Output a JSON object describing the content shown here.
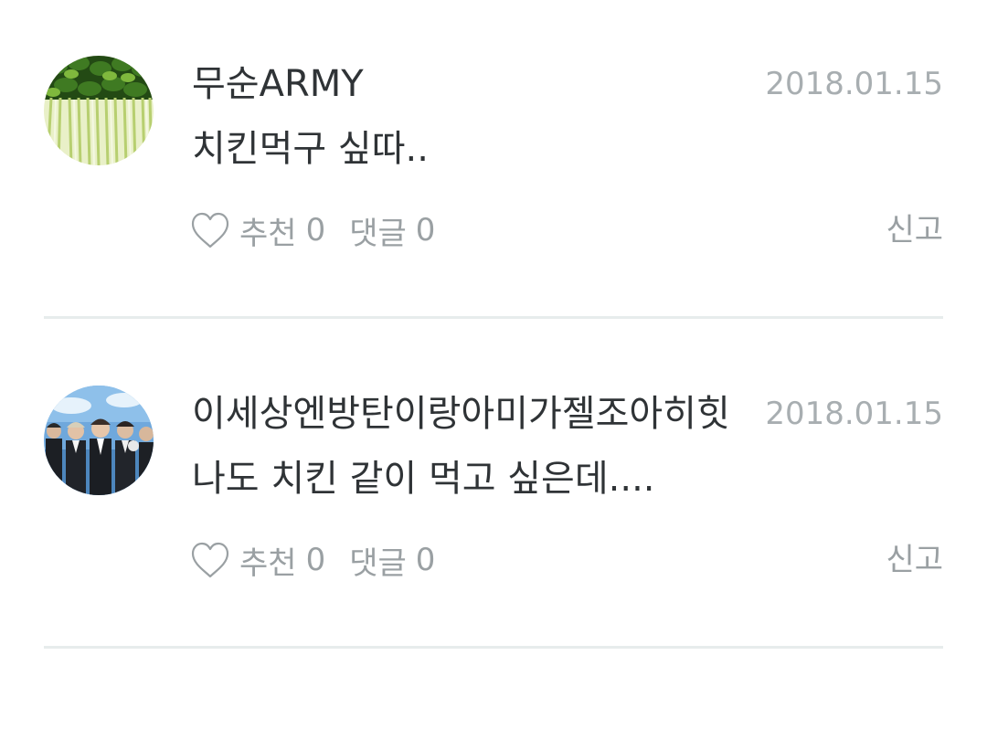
{
  "comments": [
    {
      "username": "무순ARMY",
      "date": "2018.01.15",
      "text": "치킨먹구 싶따..",
      "like_label": "추천",
      "like_count": "0",
      "reply_label": "댓글",
      "reply_count": "0",
      "report_label": "신고",
      "avatar_icon": "sprouts-avatar"
    },
    {
      "username": "이세상엔방탄이랑아미가젤조아히힛",
      "date": "2018.01.15",
      "text": "나도 치킨 같이 먹고 싶은데....",
      "like_label": "추천",
      "like_count": "0",
      "reply_label": "댓글",
      "reply_count": "0",
      "report_label": "신고",
      "avatar_icon": "group-photo-avatar"
    }
  ],
  "colors": {
    "text": "#2f3336",
    "meta": "#9aa0a3",
    "date": "#a8aeb1",
    "divider": "#e7ecec"
  }
}
